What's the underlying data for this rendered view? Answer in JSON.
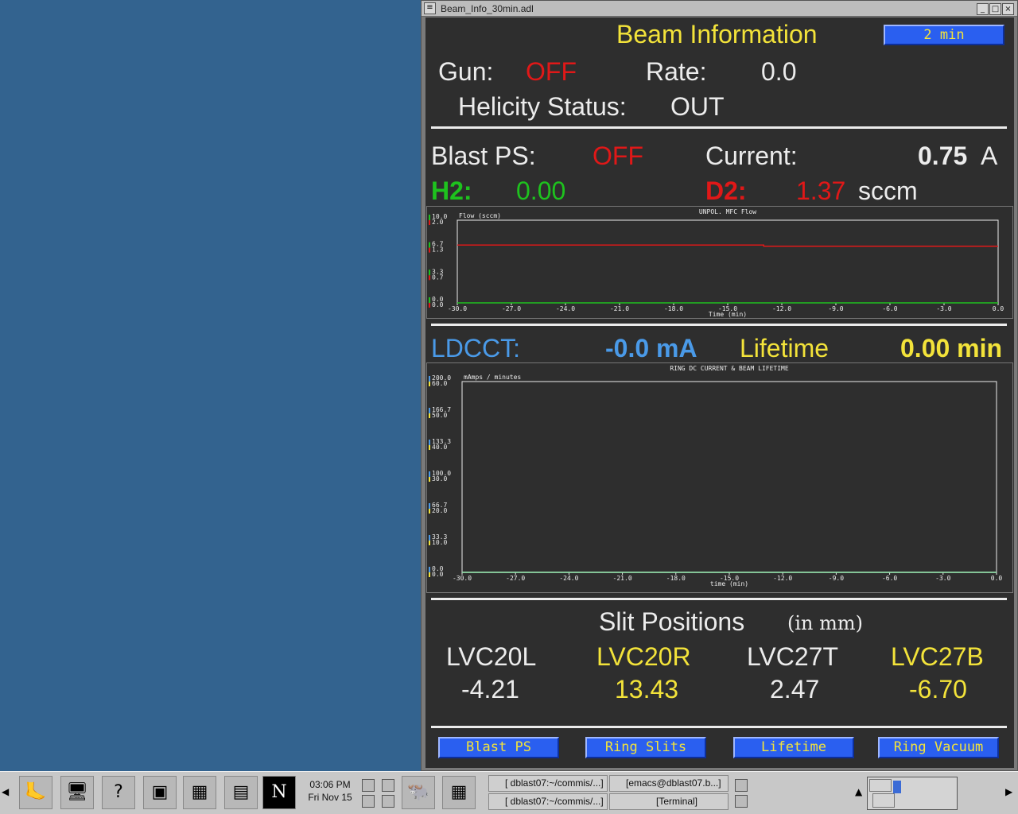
{
  "window": {
    "title": "Beam_Info_30min.adl"
  },
  "header": {
    "title": "Beam Information",
    "interval_button": "2 min"
  },
  "gun": {
    "label": "Gun:",
    "value": "OFF",
    "rate_label": "Rate:",
    "rate_value": "0.0"
  },
  "helicity": {
    "label": "Helicity Status:",
    "value": "OUT"
  },
  "blast": {
    "label": "Blast PS:",
    "value": "OFF",
    "current_label": "Current:",
    "current_value": "0.75",
    "current_unit": "A"
  },
  "gas": {
    "h2_label": "H2:",
    "h2_value": "0.00",
    "d2_label": "D2:",
    "d2_value": "1.37",
    "unit": "sccm"
  },
  "flow_chart": {
    "title": "UNPOL. MFC Flow",
    "ylabel": "Flow (sccm)",
    "xlabel": "Time (min)",
    "x_ticks": [
      "-30.0",
      "-27.0",
      "-24.0",
      "-21.0",
      "-18.0",
      "-15.0",
      "-12.0",
      "-9.0",
      "-6.0",
      "-3.0",
      "0.0"
    ],
    "y_ticks_green": [
      "10.0",
      "6.7",
      "3.3",
      "0.0"
    ],
    "y_ticks_red": [
      "2.0",
      "1.3",
      "0.7",
      "0.0"
    ],
    "colors": {
      "h2": "#1ec21e",
      "d2": "#e01818"
    }
  },
  "ldcct": {
    "label": "LDCCT:",
    "value": "-0.0 mA",
    "lifetime_label": "Lifetime",
    "lifetime_value": "0.00 min"
  },
  "ring_chart": {
    "title": "RING DC CURRENT & BEAM LIFETIME",
    "ylabel": "mAmps / minutes",
    "xlabel": "time (min)",
    "x_ticks": [
      "-30.0",
      "-27.0",
      "-24.0",
      "-21.0",
      "-18.0",
      "-15.0",
      "-12.0",
      "-9.0",
      "-6.0",
      "-3.0",
      "0.0"
    ],
    "y_ticks_blue": [
      "200.0",
      "166.7",
      "133.3",
      "100.0",
      "66.7",
      "33.3",
      "0.0"
    ],
    "y_ticks_yellow": [
      "60.0",
      "50.0",
      "40.0",
      "30.0",
      "20.0",
      "10.0",
      "0.0"
    ],
    "colors": {
      "current": "#4a9ae8",
      "lifetime": "#f3e33a"
    }
  },
  "chart_data": [
    {
      "type": "line",
      "title": "UNPOL. MFC Flow",
      "xlabel": "Time (min)",
      "ylabel": "Flow (sccm)",
      "xlim": [
        -30,
        0
      ],
      "series": [
        {
          "x": [
            -30,
            0
          ],
          "values": [
            0.0,
            0.0
          ]
        },
        {
          "x": [
            -30,
            -13,
            -13,
            0
          ],
          "values": [
            1.4,
            1.4,
            1.37,
            1.37
          ]
        }
      ],
      "ylim_left": [
        0,
        10
      ],
      "ylim_right": [
        0,
        2
      ]
    },
    {
      "type": "line",
      "title": "RING DC CURRENT & BEAM LIFETIME",
      "xlabel": "time (min)",
      "ylabel": "mAmps / minutes",
      "xlim": [
        -30,
        0
      ],
      "series": [
        {
          "x": [
            -30,
            0
          ],
          "values": [
            0.0,
            0.0
          ]
        },
        {
          "x": [
            -30,
            0
          ],
          "values": [
            0.0,
            0.0
          ]
        }
      ],
      "ylim_left": [
        0,
        200
      ],
      "ylim_right": [
        0,
        60
      ]
    }
  ],
  "slits": {
    "title": "Slit Positions",
    "unit": "(in mm)",
    "items": [
      {
        "name": "LVC20L",
        "value": "-4.21",
        "color": "white"
      },
      {
        "name": "LVC20R",
        "value": "13.43",
        "color": "yellow"
      },
      {
        "name": "LVC27T",
        "value": "2.47",
        "color": "white"
      },
      {
        "name": "LVC27B",
        "value": "-6.70",
        "color": "yellow"
      }
    ]
  },
  "buttons": {
    "blast_ps": "Blast PS",
    "ring_slits": "Ring Slits",
    "lifetime": "Lifetime",
    "ring_vacuum": "Ring Vacuum"
  },
  "taskbar": {
    "clock_time": "03:06 PM",
    "clock_date": "Fri Nov 15",
    "tasks": [
      "[ dblast07:~/commis/...]",
      "[emacs@dblast07.b...]",
      "[ dblast07:~/commis/...]",
      "[Terminal]"
    ]
  }
}
